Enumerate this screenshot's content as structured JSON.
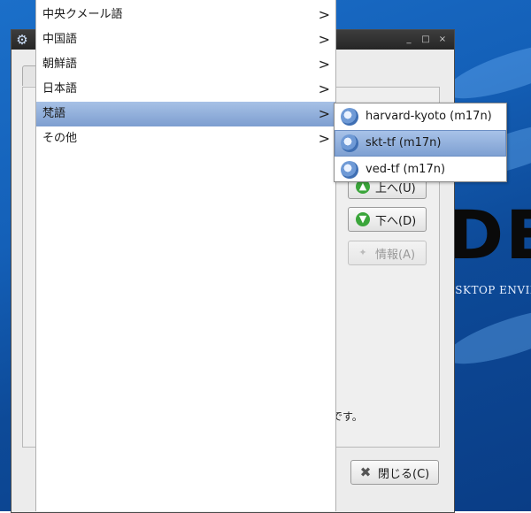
{
  "menu": {
    "items": [
      {
        "label": "中央クメール語",
        "arrow": ">"
      },
      {
        "label": "中国語",
        "arrow": ">"
      },
      {
        "label": "朝鮮語",
        "arrow": ">"
      },
      {
        "label": "日本語",
        "arrow": ">"
      },
      {
        "label": "梵語",
        "arrow": ">"
      },
      {
        "label": "その他",
        "arrow": ">"
      }
    ],
    "selected_index": 4
  },
  "submenu": {
    "items": [
      {
        "label": "harvard-kyoto (m17n)",
        "icon": "gear-icon"
      },
      {
        "label": "skt-tf (m17n)",
        "icon": "gear-icon"
      },
      {
        "label": "ved-tf (m17n)",
        "icon": "gear-icon"
      }
    ],
    "selected_index": 1
  },
  "window": {
    "buttons": {
      "up_label": "上へ(U)",
      "down_label": "下へ(D)",
      "info_label": "情報(A)",
      "close_label": "閉じる(C)"
    },
    "note_text": "です。",
    "titlebar_min": "_",
    "titlebar_max": "□",
    "titlebar_close": "×"
  },
  "desktop": {
    "logo_text": "DE",
    "logo_subtitle": "ESKTOP ENVIRON"
  },
  "colors": {
    "menu_selected": "#7d9ed0",
    "desktop_blue": "#1460b8",
    "green_icon": "#3aa53a"
  }
}
